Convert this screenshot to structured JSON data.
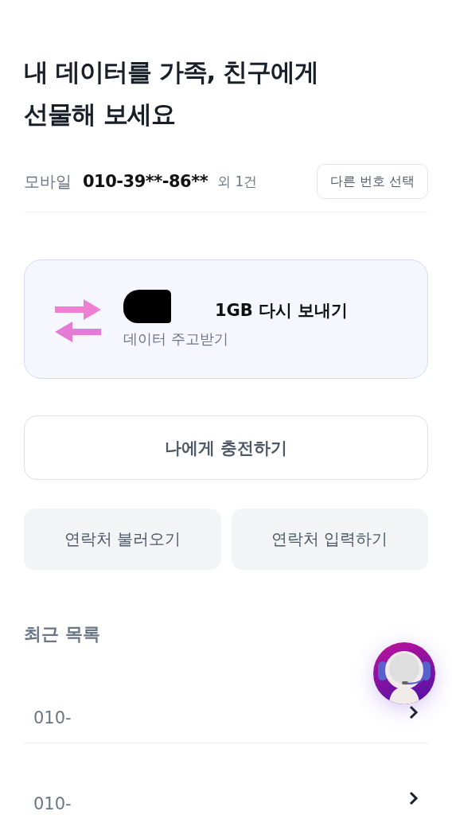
{
  "title": "내 데이터를 가족, 친구에게\n선물해 보세요",
  "line": {
    "type_label": "모바일",
    "number": "010-39**-86**",
    "extra": "외 1건",
    "change_button": "다른 번호 선택"
  },
  "resend_card": {
    "title": "1GB 다시 보내기",
    "subtitle": "데이터 주고받기"
  },
  "charge_button": "나에게 충전하기",
  "contact_buttons": [
    "연락처 불러오기",
    "연락처 입력하기"
  ],
  "recent": {
    "heading": "최근 목록",
    "items": [
      {
        "number": "010-"
      },
      {
        "number": "010-"
      }
    ]
  }
}
